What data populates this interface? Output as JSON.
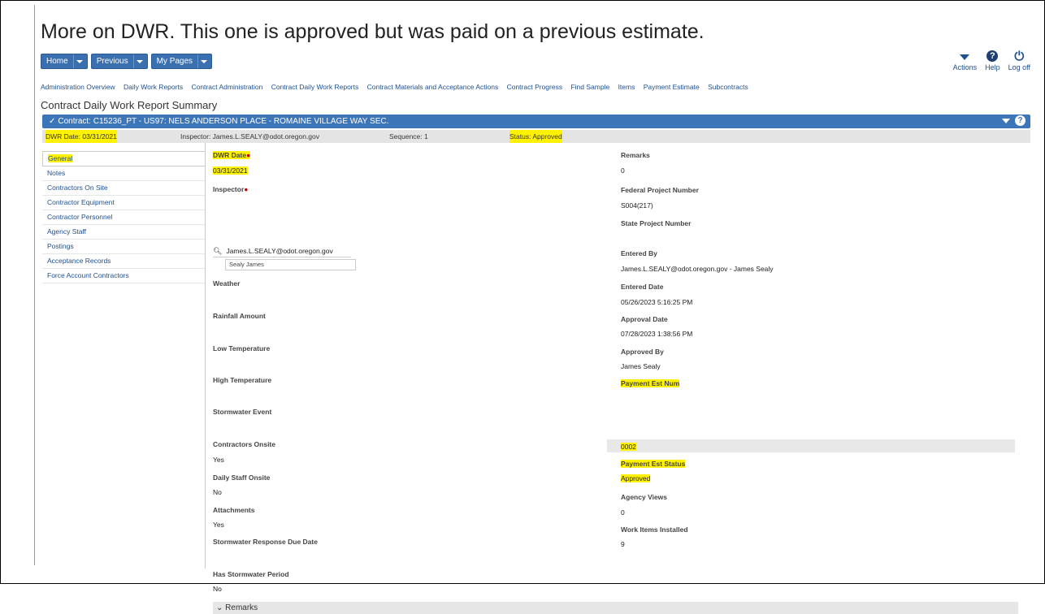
{
  "slide": {
    "title": "More on DWR.  This one is approved but was paid on a previous estimate."
  },
  "topnav": {
    "buttons": [
      {
        "label": "Home"
      },
      {
        "label": "Previous"
      },
      {
        "label": "My Pages"
      }
    ],
    "right": {
      "actions": "Actions",
      "help": "Help",
      "logoff": "Log off"
    }
  },
  "links": [
    "Administration Overview",
    "Daily Work Reports",
    "Contract Administration",
    "Contract Daily Work Reports",
    "Contract Materials and Acceptance Actions",
    "Contract Progress",
    "Find Sample",
    "Items",
    "Payment Estimate",
    "Subcontracts"
  ],
  "page_title": "Contract Daily Work Report Summary",
  "contract_bar": "Contract: C15236_PT - US97: NELS ANDERSON PLACE - ROMAINE VILLAGE WAY SEC.",
  "info": {
    "dwr_date": "DWR Date: 03/31/2021",
    "inspector": "Inspector: James.L.SEALY@odot.oregon.gov",
    "sequence": "Sequence: 1",
    "status": "Status: Approved"
  },
  "sidenav": [
    "General",
    "Notes",
    "Contractors On Site",
    "Contractor Equipment",
    "Contractor Personnel",
    "Agency Staff",
    "Postings",
    "Acceptance Records",
    "Force Account Contractors"
  ],
  "left_fields": {
    "dwr_date_label": "DWR Date",
    "dwr_date_value": "03/31/2021",
    "inspector_label": "Inspector",
    "inspector_value": "James.L.SEALY@odot.oregon.gov",
    "inspector_suggestion": "Sealy James",
    "weather": "Weather",
    "rainfall": "Rainfall Amount",
    "low_temp": "Low Temperature",
    "high_temp": "High Temperature",
    "stormwater_event": "Stormwater Event",
    "contractors_onsite_label": "Contractors Onsite",
    "contractors_onsite_value": "Yes",
    "daily_staff_label": "Daily Staff Onsite",
    "daily_staff_value": "No",
    "attachments_label": "Attachments",
    "attachments_value": "Yes",
    "stormwater_due": "Stormwater Response Due Date",
    "has_stormwater_label": "Has Stormwater Period",
    "has_stormwater_value": "No"
  },
  "right_fields": {
    "remarks_label": "Remarks",
    "remarks_value": "0",
    "fed_proj_label": "Federal Project Number",
    "fed_proj_value": "S004(217)",
    "state_proj_label": "State Project Number",
    "entered_by_label": "Entered By",
    "entered_by_value": "James.L.SEALY@odot.oregon.gov - James Sealy",
    "entered_date_label": "Entered Date",
    "entered_date_value": "05/26/2023 5:16:25 PM",
    "approval_date_label": "Approval Date",
    "approval_date_value": "07/28/2023 1:38:56 PM",
    "approved_by_label": "Approved By",
    "approved_by_value": "James Sealy",
    "pay_est_num_label": "Payment Est Num",
    "pay_est_num_value": "0002",
    "pay_est_status_label": "Payment Est Status",
    "pay_est_status_value": "Approved",
    "agency_views_label": "Agency Views",
    "agency_views_value": "0",
    "work_items_label": "Work Items Installed",
    "work_items_value": "9"
  },
  "remarks_section": "Remarks"
}
